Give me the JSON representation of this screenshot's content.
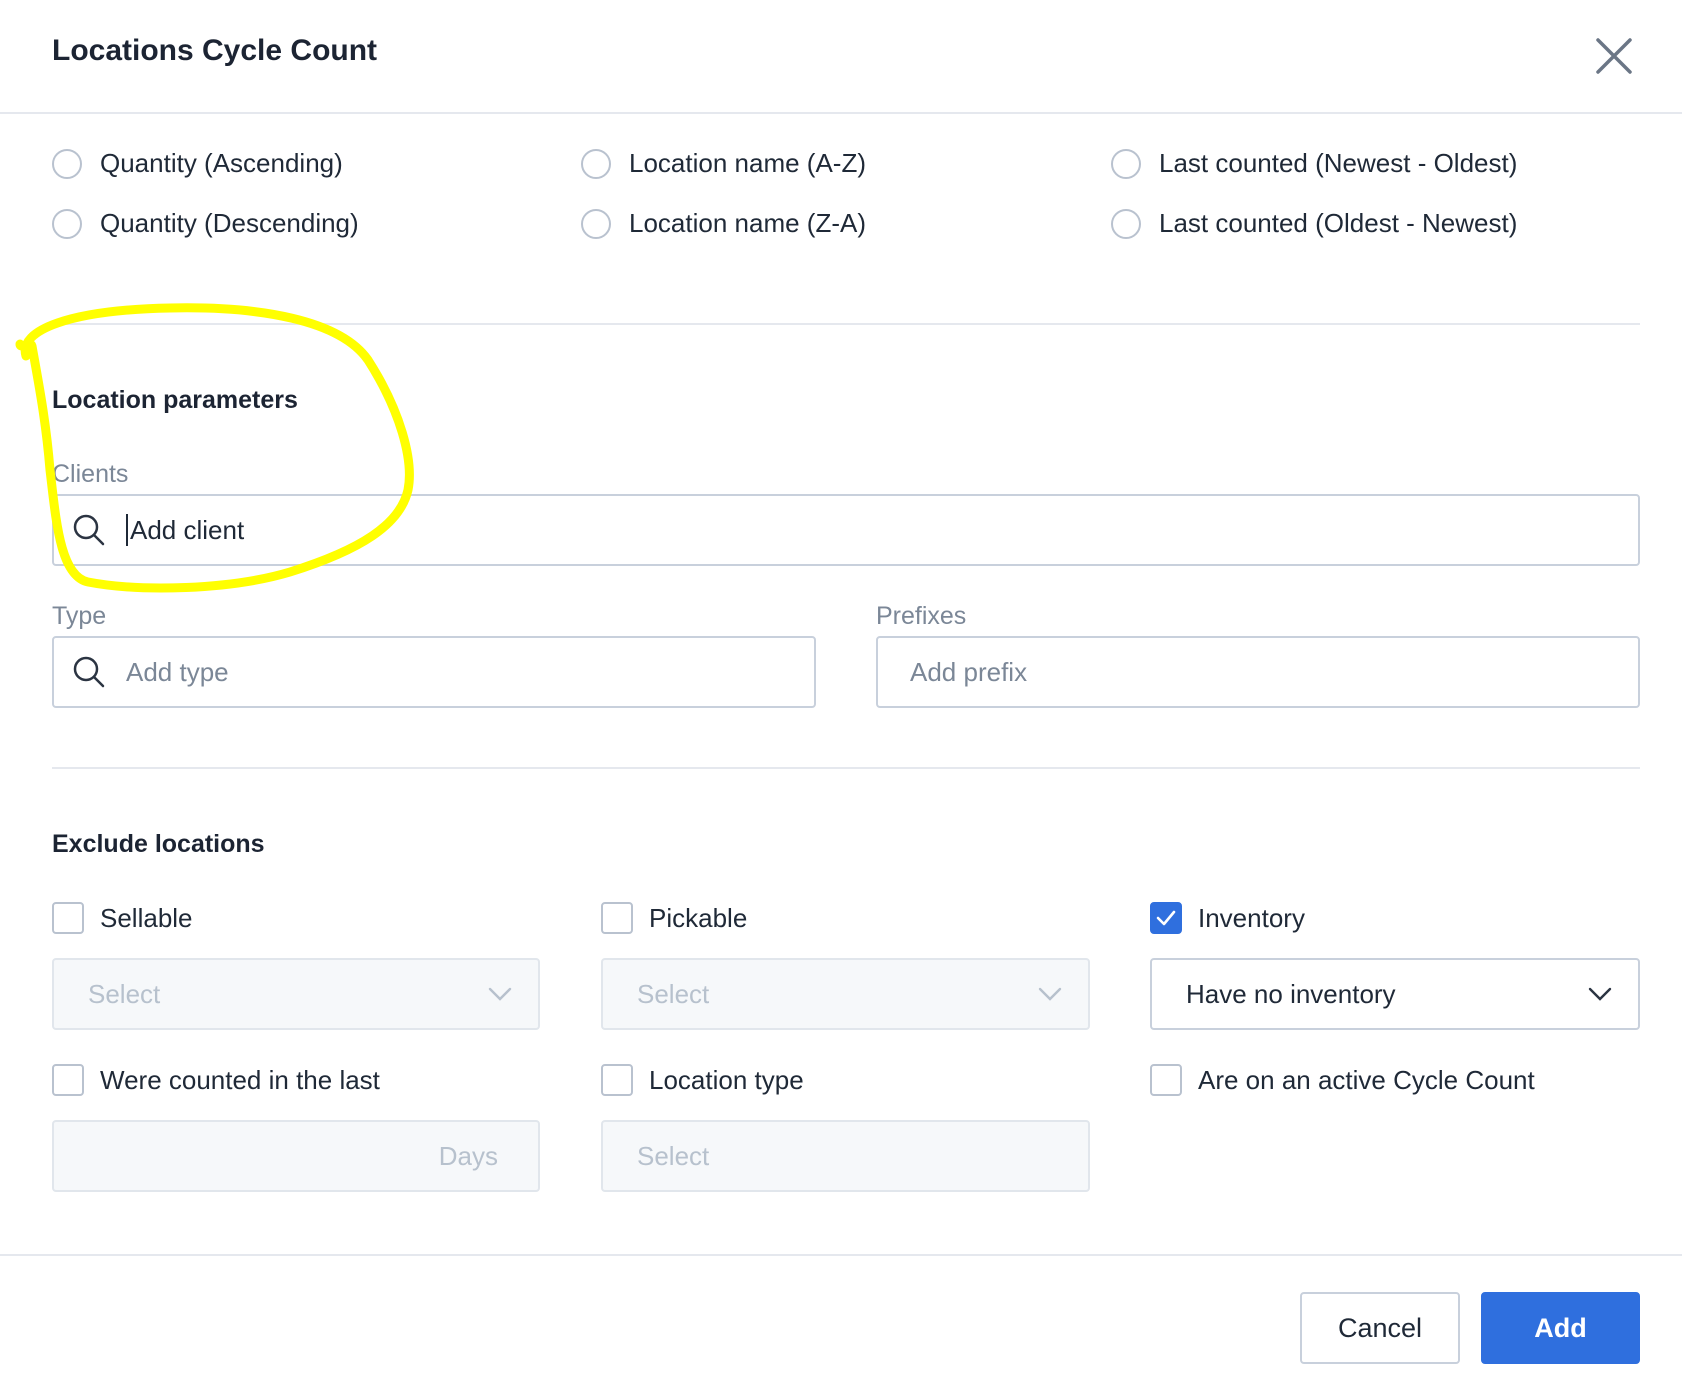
{
  "modal": {
    "title": "Locations Cycle Count"
  },
  "sort": {
    "options": [
      "Quantity (Ascending)",
      "Location name (A-Z)",
      "Last counted (Newest - Oldest)",
      "Quantity (Descending)",
      "Location name (Z-A)",
      "Last counted (Oldest - Newest)"
    ]
  },
  "location_parameters": {
    "title": "Location parameters",
    "clients_label": "Clients",
    "clients_placeholder": "Add client",
    "type_label": "Type",
    "type_placeholder": "Add type",
    "prefixes_label": "Prefixes",
    "prefixes_placeholder": "Add prefix"
  },
  "exclude": {
    "title": "Exclude locations",
    "sellable_label": "Sellable",
    "sellable_select": "Select",
    "pickable_label": "Pickable",
    "pickable_select": "Select",
    "inventory_label": "Inventory",
    "inventory_checked": true,
    "inventory_select": "Have no inventory",
    "counted_label": "Were counted in the last",
    "counted_unit": "Days",
    "location_type_label": "Location type",
    "location_type_select": "Select",
    "active_cycle_label": "Are on an active Cycle Count"
  },
  "footer": {
    "cancel_label": "Cancel",
    "add_label": "Add"
  },
  "colors": {
    "primary": "#2f6fde",
    "highlight": "#ffff00"
  }
}
